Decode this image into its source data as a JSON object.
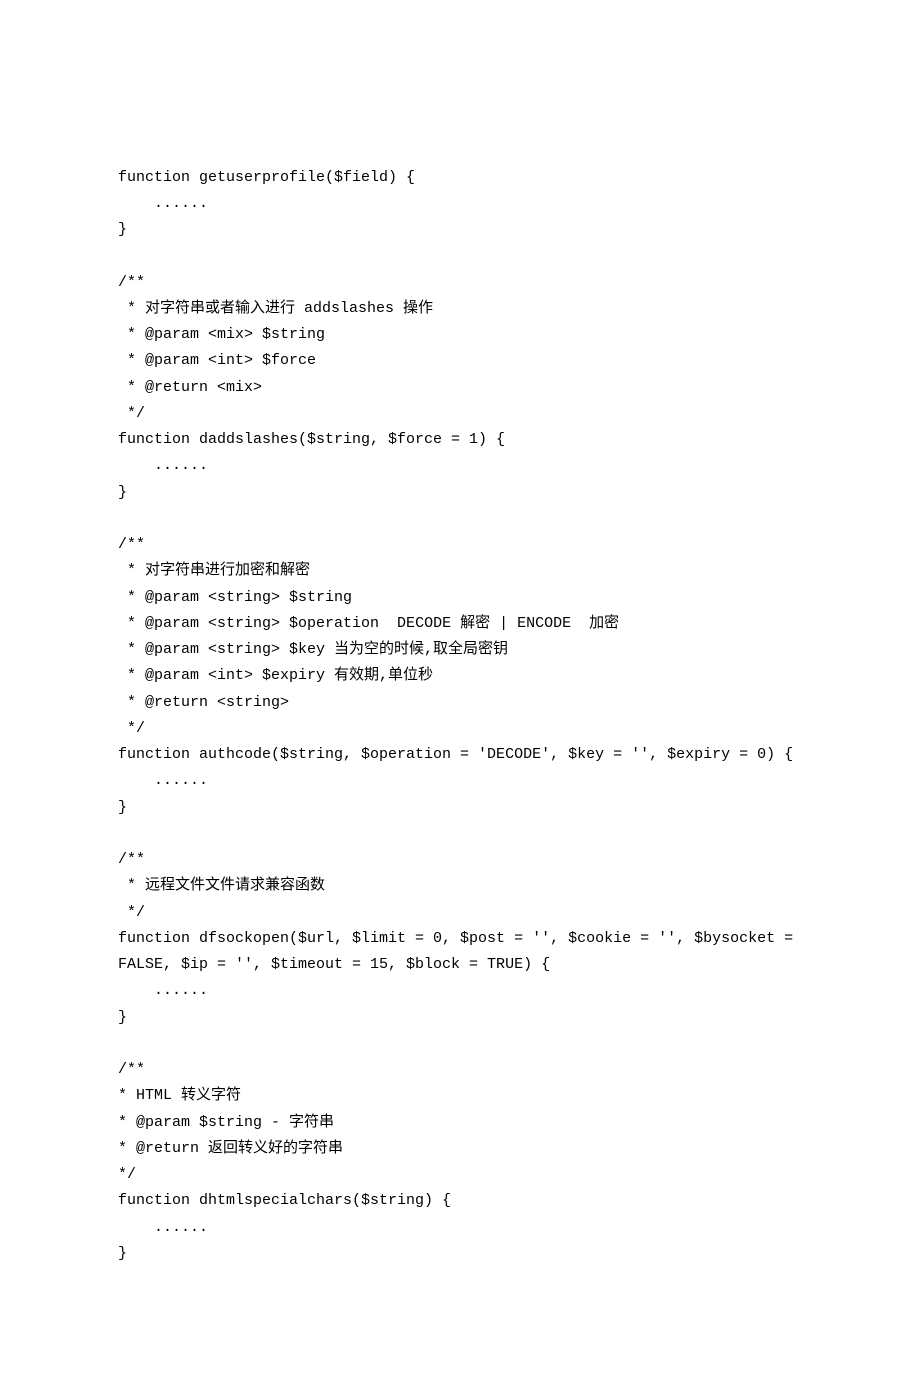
{
  "code": {
    "lines": [
      "function getuserprofile($field) {",
      "    ......",
      "}",
      "",
      "/**",
      " * 对字符串或者输入进行 addslashes 操作",
      " * @param <mix> $string",
      " * @param <int> $force",
      " * @return <mix>",
      " */",
      "function daddslashes($string, $force = 1) {",
      "    ......",
      "}",
      "",
      "/**",
      " * 对字符串进行加密和解密",
      " * @param <string> $string",
      " * @param <string> $operation  DECODE 解密 | ENCODE  加密",
      " * @param <string> $key 当为空的时候,取全局密钥",
      " * @param <int> $expiry 有效期,单位秒",
      " * @return <string>",
      " */",
      "function authcode($string, $operation = 'DECODE', $key = '', $expiry = 0) {",
      "    ......",
      "}",
      "",
      "/**",
      " * 远程文件文件请求兼容函数",
      " */",
      "function dfsockopen($url, $limit = 0, $post = '', $cookie = '', $bysocket = FALSE, $ip = '', $timeout = 15, $block = TRUE) {",
      "    ......",
      "}",
      "",
      "/**",
      "* HTML 转义字符",
      "* @param $string - 字符串",
      "* @return 返回转义好的字符串",
      "*/",
      "function dhtmlspecialchars($string) {",
      "    ......",
      "}"
    ]
  }
}
